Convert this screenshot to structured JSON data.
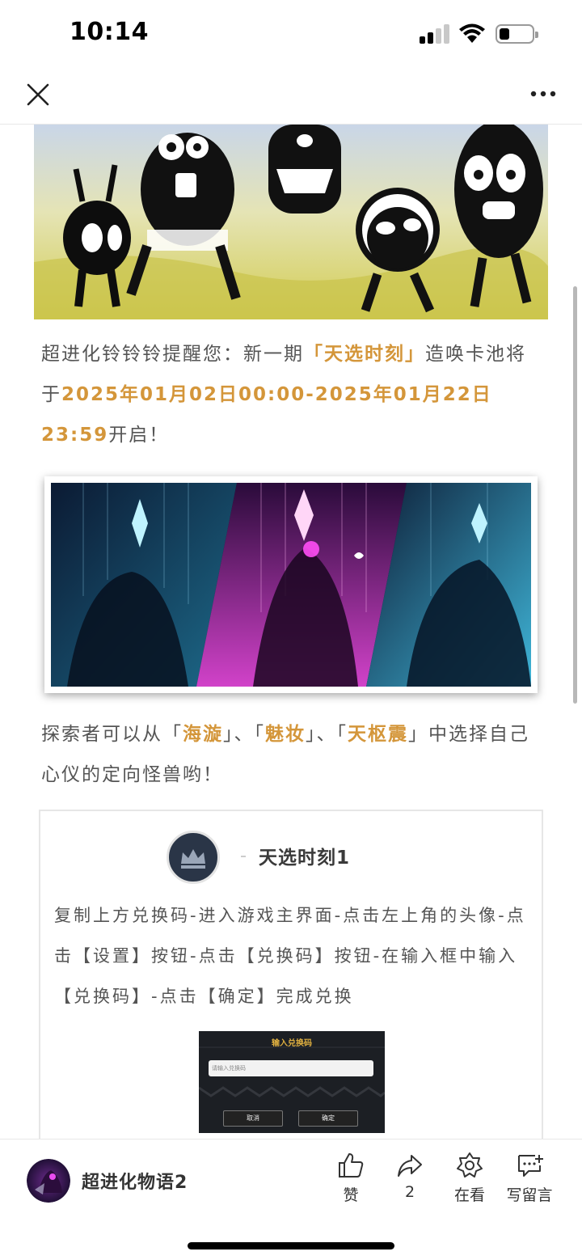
{
  "status_bar": {
    "time": "10:14"
  },
  "nav": {
    "close_icon": "close-icon",
    "more_icon": "more-icon"
  },
  "article": {
    "intro": {
      "part1": "超进化铃铃铃提醒您：新一期",
      "event_name": "「天选时刻」",
      "part2": "造唤卡池将于",
      "date_range": "2025年01月02日00:00-2025年01月22日23:59",
      "part3": "开启！"
    },
    "choice": {
      "part1": "探索者可以从「",
      "option1": "海漩",
      "sep1": "」、「",
      "option2": "魅妆",
      "sep2": "」、「",
      "option3": "天枢震",
      "part2": "」中选择自己心仪的定向怪兽哟！"
    },
    "card": {
      "title": "天选时刻1",
      "instructions": "复制上方兑换码-进入游戏主界面-点击左上角的头像-点击【设置】按钮-点击【兑换码】按钮-在输入框中输入【兑换码】-点击【确定】完成兑换",
      "dialog": {
        "title": "输入兑换码",
        "placeholder": "请输入兑换码",
        "cancel": "取消",
        "confirm": "确定"
      }
    }
  },
  "bottom_bar": {
    "account_name": "超进化物语2",
    "actions": [
      {
        "icon": "thumbs-up-icon",
        "label": "赞"
      },
      {
        "icon": "share-icon",
        "label": "2"
      },
      {
        "icon": "wow-icon",
        "label": "在看"
      },
      {
        "icon": "comment-icon",
        "label": "写留言"
      }
    ]
  },
  "colors": {
    "highlight": "#d4963a",
    "body_text": "#555555"
  }
}
